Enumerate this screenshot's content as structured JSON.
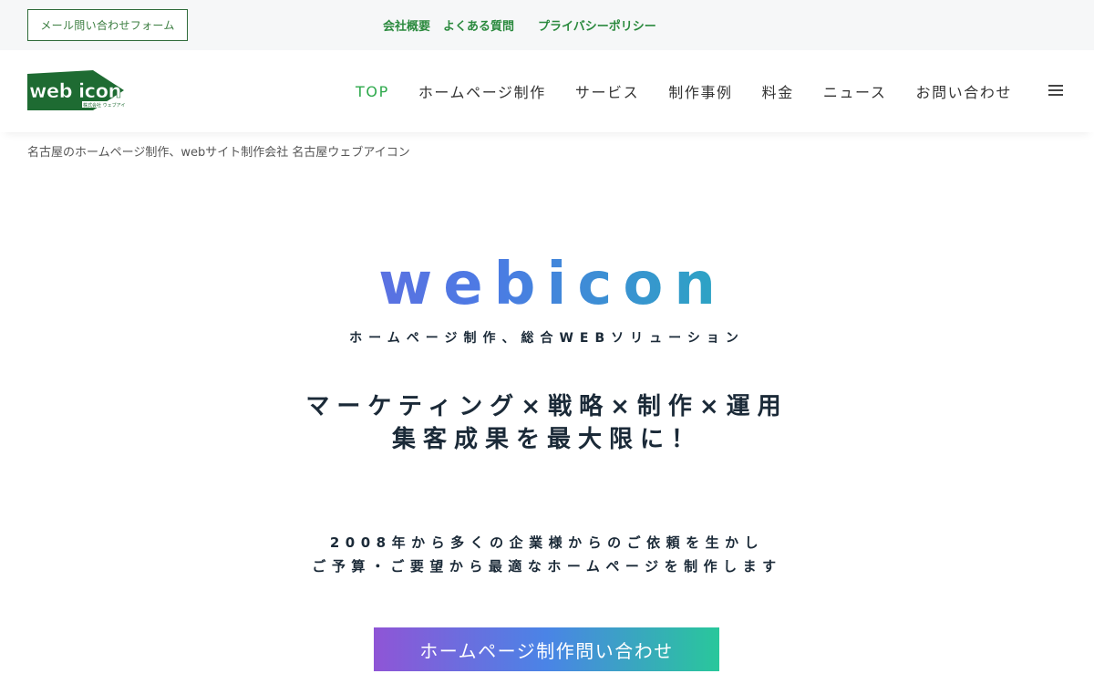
{
  "util_bar": {
    "mail_button": "メール問い合わせフォーム",
    "links": [
      "会社概要",
      "よくある質問",
      "プライバシーポリシー"
    ]
  },
  "header": {
    "logo_alt": "web icon",
    "nav": [
      {
        "label": "TOP",
        "active": true
      },
      {
        "label": "ホームページ制作",
        "active": false
      },
      {
        "label": "サービス",
        "active": false
      },
      {
        "label": "制作事例",
        "active": false
      },
      {
        "label": "料金",
        "active": false
      },
      {
        "label": "ニュース",
        "active": false
      },
      {
        "label": "お問い合わせ",
        "active": false
      }
    ],
    "menu_icon": "hamburger-icon"
  },
  "breadcrumb": "名古屋のホームページ制作、webサイト制作会社 名古屋ウェブアイコン",
  "hero": {
    "logo_text": "webicon",
    "subtitle": "ホームページ制作、総合WEBソリューション",
    "headline_line1": "マーケティング×戦略×制作×運用",
    "headline_line2": "集客成果を最大限に！",
    "desc_line1": "2008年から多くの企業様からのご依頼を生かし",
    "desc_line2": "ご予算・ご要望から最適なホームページを制作します",
    "cta_label": "ホームページ制作問い合わせ"
  },
  "colors": {
    "accent_green": "#2ea94c",
    "logo_green": "#1e6b32",
    "gradient_start": "#8e4fd8",
    "gradient_end": "#2ecf96",
    "text_dark": "#1b2a38"
  }
}
